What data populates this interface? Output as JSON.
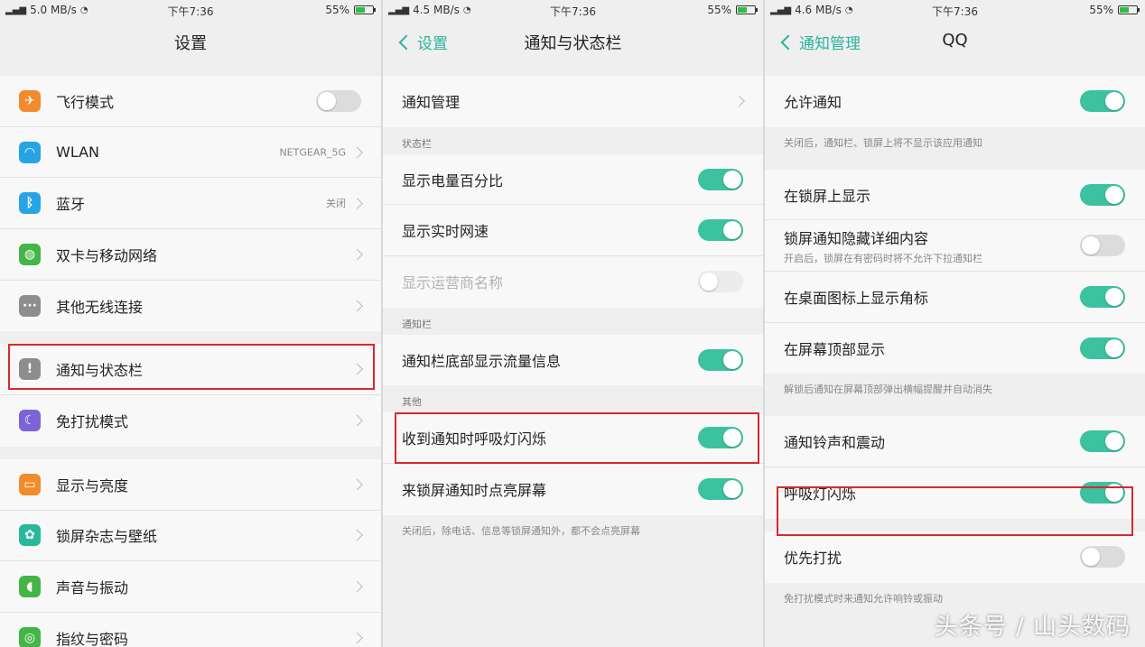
{
  "colors": {
    "accent": "#2bb39a",
    "toggle_on": "#3cc1a1",
    "highlight": "#d8282f"
  },
  "screen1": {
    "status": {
      "speed": "5.0 MB/s",
      "time": "下午7:36",
      "battery": "55%"
    },
    "title": "设置",
    "groups": [
      [
        {
          "label": "飞行模式",
          "icon": "airplane-icon",
          "icon_color": "#f08c2b",
          "control": "toggle",
          "state": "off"
        },
        {
          "label": "WLAN",
          "icon": "wifi-icon",
          "icon_color": "#26a4e6",
          "value": "NETGEAR_5G",
          "control": "chevron"
        },
        {
          "label": "蓝牙",
          "icon": "bluetooth-icon",
          "icon_color": "#26a4e6",
          "value": "关闭",
          "control": "chevron"
        },
        {
          "label": "双卡与移动网络",
          "icon": "globe-icon",
          "icon_color": "#44b547",
          "control": "chevron"
        },
        {
          "label": "其他无线连接",
          "icon": "more-icon",
          "icon_color": "#8d8d8d",
          "control": "chevron"
        }
      ],
      [
        {
          "label": "通知与状态栏",
          "icon": "alert-icon",
          "icon_color": "#8d8d8d",
          "control": "chevron",
          "highlighted": true
        },
        {
          "label": "免打扰模式",
          "icon": "moon-icon",
          "icon_color": "#7c63d8",
          "control": "chevron"
        }
      ],
      [
        {
          "label": "显示与亮度",
          "icon": "display-icon",
          "icon_color": "#f08c2b",
          "control": "chevron"
        },
        {
          "label": "锁屏杂志与壁纸",
          "icon": "flower-icon",
          "icon_color": "#2ab89a",
          "control": "chevron"
        },
        {
          "label": "声音与振动",
          "icon": "speaker-icon",
          "icon_color": "#44b547",
          "control": "chevron"
        },
        {
          "label": "指纹与密码",
          "icon": "fingerprint-icon",
          "icon_color": "#44b547",
          "control": "chevron"
        }
      ]
    ]
  },
  "screen2": {
    "status": {
      "speed": "4.5 MB/s",
      "time": "下午7:36",
      "battery": "55%"
    },
    "back_label": "设置",
    "title": "通知与状态栏",
    "row_notify_manage": "通知管理",
    "section_statusbar": "状态栏",
    "statusbar_rows": [
      {
        "label": "显示电量百分比",
        "state": "on"
      },
      {
        "label": "显示实时网速",
        "state": "on"
      },
      {
        "label": "显示运营商名称",
        "state": "disabled"
      }
    ],
    "section_notifybar": "通知栏",
    "notifybar_rows": [
      {
        "label": "通知栏底部显示流量信息",
        "state": "on"
      }
    ],
    "section_other": "其他",
    "other_rows": [
      {
        "label": "收到通知时呼吸灯闪烁",
        "state": "on",
        "highlighted": true
      },
      {
        "label": "来锁屏通知时点亮屏幕",
        "state": "on"
      }
    ],
    "note_bottom": "关闭后，除电话、信息等锁屏通知外，都不会点亮屏幕"
  },
  "screen3": {
    "status": {
      "speed": "4.6 MB/s",
      "time": "下午7:36",
      "battery": "55%"
    },
    "back_label": "通知管理",
    "title": "QQ",
    "allow_row": {
      "label": "允许通知",
      "state": "on"
    },
    "allow_note": "关闭后，通知栏、锁屏上将不显示该应用通知",
    "group2": [
      {
        "label": "在锁屏上显示",
        "state": "on"
      },
      {
        "label": "锁屏通知隐藏详细内容",
        "sub": "开启后，锁屏在有密码时将不允许下拉通知栏",
        "state": "off"
      },
      {
        "label": "在桌面图标上显示角标",
        "state": "on"
      },
      {
        "label": "在屏幕顶部显示",
        "state": "on"
      }
    ],
    "group2_note": "解锁后通知在屏幕顶部弹出横幅提醒并自动消失",
    "group3": [
      {
        "label": "通知铃声和震动",
        "state": "on"
      },
      {
        "label": "呼吸灯闪烁",
        "state": "on",
        "highlighted": true
      }
    ],
    "group4": [
      {
        "label": "优先打扰",
        "state": "off"
      }
    ],
    "group4_note": "免打扰模式时来通知允许响铃或振动"
  },
  "watermark": "头条号 / 山头数码"
}
